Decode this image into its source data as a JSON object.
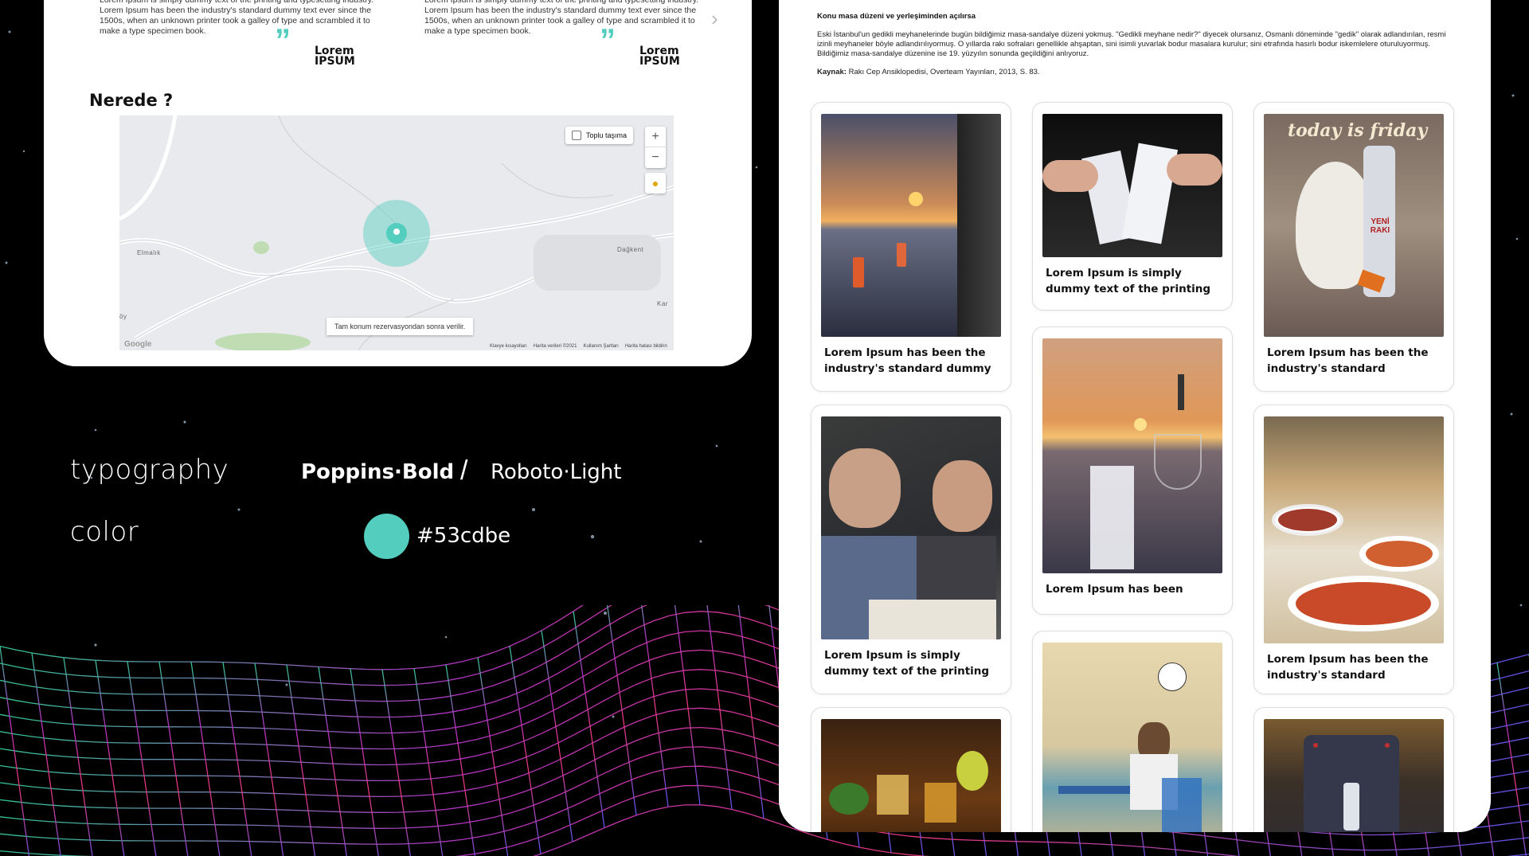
{
  "testimonials": [
    {
      "text": "Lorem Ipsum is simply dummy text of the printing and typesetting industry. Lorem Ipsum has been the industry's standard dummy text ever since the 1500s, when an unknown printer took a galley of type and scrambled it to make a type specimen book.",
      "author": "Lorem IPSUM"
    },
    {
      "text": "Lorem Ipsum is simply dummy text of the printing and typesetting industry. Lorem Ipsum has been the industry's standard dummy text ever since the 1500s, when an unknown printer took a galley of type and scrambled it to make a type specimen book.",
      "author": "Lorem IPSUM"
    }
  ],
  "location": {
    "heading": "Nerede ?",
    "transit_label": "Toplu taşıma",
    "note": "Tam konum rezervasyondan sonra verilir.",
    "places": [
      "Elmalık",
      "Dağkent",
      "Kar",
      "öy"
    ],
    "google": "Google",
    "footer": [
      "Klavye kısayolları",
      "Harita verileri ©2021",
      "Kullanım Şartları",
      "Harita hatası bildirin"
    ]
  },
  "style_guide": {
    "typography_label": "typography",
    "color_label": "color",
    "font_primary": "Poppins·Bold",
    "separator": "/",
    "font_secondary": "Roboto·Light",
    "color_hex": "#53cdbe"
  },
  "article": {
    "title": "Konu masa düzeni ve yerleşiminden açılırsa",
    "body": "Eski İstanbul'un gedikli meyhanelerinde bugün bildiğimiz masa-sandalye düzeni yokmuş. \"Gedikli meyhane nedir?\" diyecek olursanız, Osmanlı döneminde \"gedik\" olarak adlandırılan, resmi izinli meyhaneler böyle adlandırılıyormuş. O yıllarda rakı sofraları genellikle ahşaptan, sini isimli yuvarlak bodur masalara kurulur; sini etrafında hasırlı bodur iskemlelere oturuluyormuş. Bildiğimiz masa-sandalye düzenine ise 19. yüzyılın sonunda geçildiğini anlıyoruz.",
    "source_label": "Kaynak:",
    "source": "Rakı Cep Ansiklopedisi, Overteam Yayınları, 2013, S. 83."
  },
  "gallery": [
    {
      "caption": "Lorem Ipsum has been the industry's standard dummy",
      "scene": "sunset-terrace"
    },
    {
      "caption": "Lorem Ipsum is simply dummy text of the printing",
      "scene": "toast-glasses"
    },
    {
      "caption": "Lorem Ipsum has been the industry's standard",
      "scene": "today-is-friday-poster"
    },
    {
      "caption": "Lorem Ipsum has been",
      "scene": "sunset-raki-glass"
    },
    {
      "caption": "Lorem Ipsum is simply dummy text of the printing",
      "scene": "vintage-photo-men"
    },
    {
      "caption": "Lorem Ipsum has been the industry's standard",
      "scene": "meze-plates"
    },
    {
      "caption": "",
      "scene": "drinks-fruits"
    },
    {
      "caption": "",
      "scene": "illustration-man-table"
    },
    {
      "caption": "",
      "scene": "apron-bottle"
    }
  ],
  "poster_text": {
    "title": "today is friday",
    "brand": "YENİ RAKI"
  },
  "colors": {
    "accent": "#53cdbe",
    "background": "#000000",
    "card": "#ffffff"
  }
}
